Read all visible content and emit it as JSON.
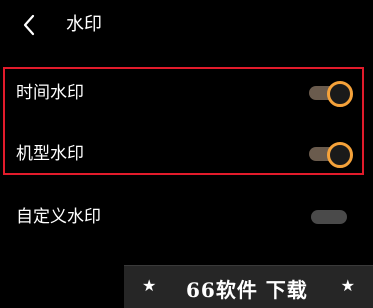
{
  "header": {
    "title": "水印"
  },
  "rows": [
    {
      "label": "时间水印",
      "enabled": true
    },
    {
      "label": "机型水印",
      "enabled": true
    },
    {
      "label": "自定义水印",
      "enabled": false
    }
  ],
  "colors": {
    "accent": "#f5a23a",
    "highlight_border": "#e21b2b",
    "track_on": "#6a5b4d",
    "track_off": "#4a4a4a"
  },
  "watermark": {
    "text": "66软件 下载",
    "star": "★"
  }
}
